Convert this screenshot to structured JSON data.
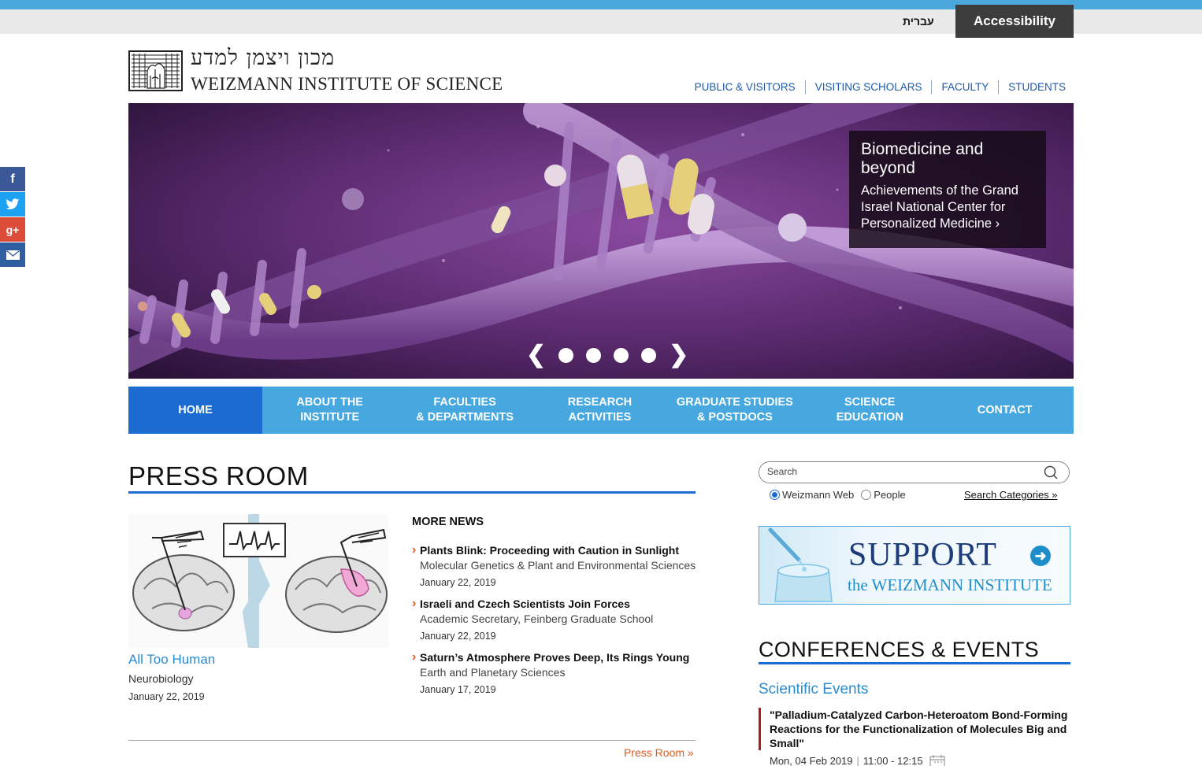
{
  "util": {
    "hebrew": "עברית",
    "accessibility": "Accessibility"
  },
  "logo": {
    "hebrew": "מכון ויצמן למדע",
    "english": "WEIZMANN INSTITUTE OF SCIENCE"
  },
  "topnav": [
    "PUBLIC & VISITORS",
    "VISITING SCHOLARS",
    "FACULTY",
    "STUDENTS"
  ],
  "social": [
    {
      "icon": "facebook-icon",
      "glyph": "f",
      "color": "#3b5998"
    },
    {
      "icon": "twitter-icon",
      "glyph": "t",
      "color": "#1da1f2"
    },
    {
      "icon": "google-plus-icon",
      "glyph": "g+",
      "color": "#dd4b39"
    },
    {
      "icon": "email-icon",
      "glyph": "✉",
      "color": "#2f5fa0"
    }
  ],
  "hero": {
    "title": "Biomedicine and beyond",
    "text": "Achievements of the Grand Israel National Center for Personalized Medicine ›",
    "slides": 4,
    "prev_icon": "chevron-left-icon",
    "next_icon": "chevron-right-icon"
  },
  "mainnav": [
    {
      "line1": "HOME",
      "line2": ""
    },
    {
      "line1": "ABOUT THE",
      "line2": "INSTITUTE"
    },
    {
      "line1": "FACULTIES",
      "line2": "& DEPARTMENTS"
    },
    {
      "line1": "RESEARCH",
      "line2": "ACTIVITIES"
    },
    {
      "line1": "GRADUATE STUDIES",
      "line2": "& POSTDOCS"
    },
    {
      "line1": "SCIENCE",
      "line2": "EDUCATION"
    },
    {
      "line1": "CONTACT",
      "line2": ""
    }
  ],
  "press": {
    "heading": "PRESS ROOM",
    "feature": {
      "title": "All Too Human",
      "category": "Neurobiology",
      "date": "January 22, 2019"
    },
    "more_news_heading": "MORE NEWS",
    "news": [
      {
        "title": "Plants Blink: Proceeding with Caution in Sunlight",
        "category": "Molecular Genetics & Plant and Environmental Sciences",
        "date": "January 22, 2019"
      },
      {
        "title": "Israeli and Czech Scientists Join Forces",
        "category": "Academic Secretary, Feinberg Graduate School",
        "date": "January 22, 2019"
      },
      {
        "title": "Saturn’s Atmosphere Proves Deep, Its Rings Young",
        "category": "Earth and Planetary Sciences",
        "date": "January 17, 2019"
      }
    ],
    "link": "Press Room »"
  },
  "search": {
    "placeholder": "Search",
    "options": [
      "Weizmann Web",
      "People"
    ],
    "selected": "Weizmann Web",
    "categories_link": "Search Categories »"
  },
  "support": {
    "word": "SUPPORT",
    "sub": "the WEIZMANN INSTITUTE"
  },
  "events": {
    "heading": "CONFERENCES & EVENTS",
    "subheading": "Scientific Events",
    "item": {
      "title": "\"Palladium-Catalyzed Carbon-Heteroatom Bond-Forming Reactions for the Functionalization of Molecules Big and Small\"",
      "date": "Mon, 04 Feb 2019",
      "time": "11:00 - 12:15"
    }
  }
}
